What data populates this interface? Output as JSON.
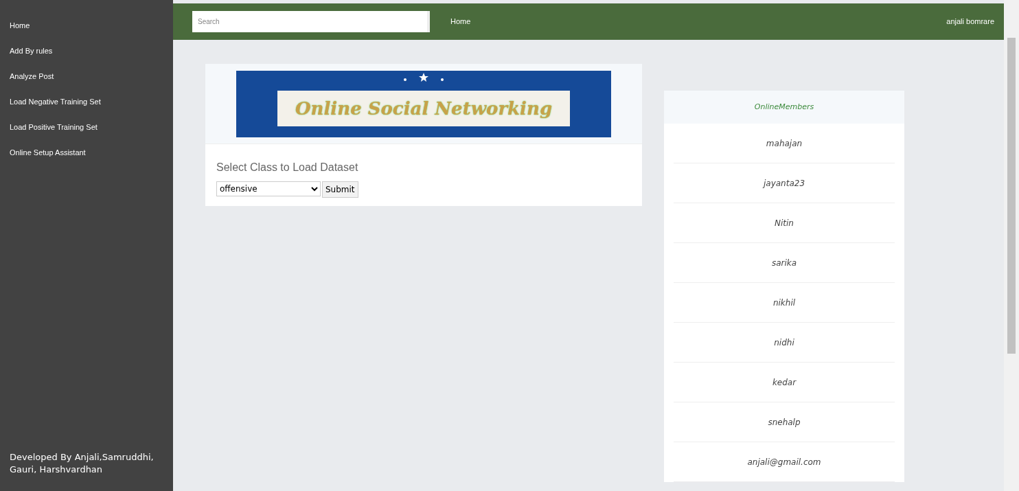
{
  "sidebar": {
    "items": [
      {
        "label": "Home"
      },
      {
        "label": "Add By rules"
      },
      {
        "label": "Analyze Post"
      },
      {
        "label": "Load Negative Training Set"
      },
      {
        "label": "Load Positive Training Set"
      },
      {
        "label": "Online Setup Assistant"
      }
    ],
    "footer": "Developed By Anjali,Samruddhi, Gauri, Harshvardhan"
  },
  "topbar": {
    "search": {
      "placeholder": "Search"
    },
    "nav": [
      "Home"
    ],
    "user": "anjali bomrare"
  },
  "banner": {
    "text": "Online Social Networking"
  },
  "form": {
    "label": "Select Class to Load Dataset",
    "select": {
      "value": "offensive"
    },
    "submit": "Submit"
  },
  "online_members": {
    "title": "OnlineMembers",
    "members": [
      "mahajan",
      "jayanta23",
      "Nitin",
      "sarika",
      "nikhil",
      "nidhi",
      "kedar",
      "snehalp",
      "anjali@gmail.com"
    ]
  }
}
